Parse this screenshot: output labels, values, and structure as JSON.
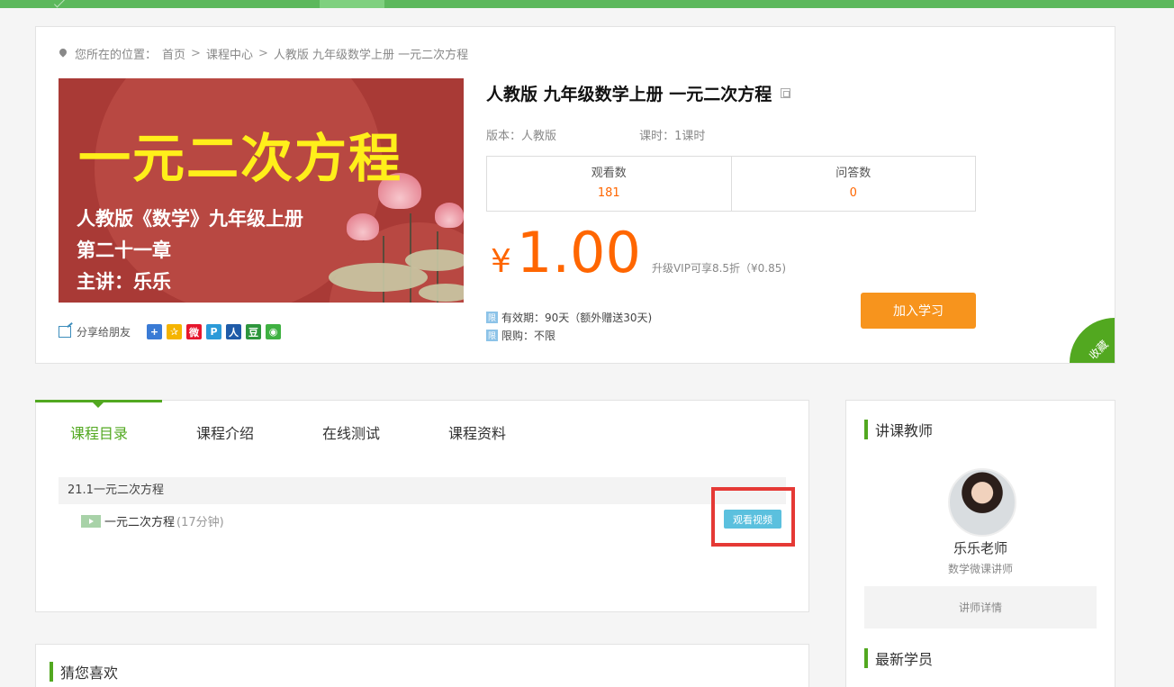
{
  "breadcrumb": {
    "prefix": "您所在的位置：",
    "items": [
      "首页",
      "课程中心",
      "人教版 九年级数学上册 一元二次方程"
    ],
    "separator": ">"
  },
  "cover": {
    "title": "一元二次方程",
    "lines": [
      "人教版《数学》九年级上册",
      "第二十一章",
      "主讲：乐乐"
    ]
  },
  "share": {
    "label": "分享给朋友",
    "icons": [
      {
        "name": "add-share-icon",
        "glyph": "+",
        "color": "#3a7bd5"
      },
      {
        "name": "qzone-icon",
        "glyph": "✰",
        "color": "#f5b400"
      },
      {
        "name": "weibo-icon",
        "glyph": "微",
        "color": "#e6162d"
      },
      {
        "name": "tencent-weibo-icon",
        "glyph": "P",
        "color": "#2b9ad8"
      },
      {
        "name": "renren-icon",
        "glyph": "人",
        "color": "#1f5ba8"
      },
      {
        "name": "douban-icon",
        "glyph": "豆",
        "color": "#2e963d"
      },
      {
        "name": "wechat-icon",
        "glyph": "◉",
        "color": "#3fb142"
      }
    ]
  },
  "course": {
    "title": "人教版 九年级数学上册 一元二次方程",
    "edition": "版本：人教版",
    "lessons": "课时：1课时",
    "stats": [
      {
        "label": "观看数",
        "value": "181"
      },
      {
        "label": "问答数",
        "value": "0"
      }
    ],
    "currency": "¥",
    "price": "1.00",
    "vip_note": "升级VIP可享8.5折（¥0.85)",
    "validity": "有效期：90天（额外赠送30天)",
    "validity_icon": "限",
    "limit": "限购：不限",
    "limit_icon": "限",
    "join_label": "加入学习",
    "favorite_label": "收藏"
  },
  "tabs": [
    "课程目录",
    "课程介绍",
    "在线测试",
    "课程资料"
  ],
  "catalog": {
    "chapter": "21.1一元二次方程",
    "lesson_title": "一元二次方程",
    "lesson_duration": "(17分钟)",
    "watch_label": "观看视频"
  },
  "guess": {
    "title": "猜您喜欢"
  },
  "teacher": {
    "section_title": "讲课教师",
    "name": "乐乐老师",
    "role": "数学微课讲师",
    "detail_label": "讲师详情",
    "students_title": "最新学员"
  },
  "colors": {
    "accent": "#52a820",
    "price": "#ff6600",
    "join": "#f7941d",
    "watch": "#5bc0de",
    "highlight": "#e53935"
  }
}
